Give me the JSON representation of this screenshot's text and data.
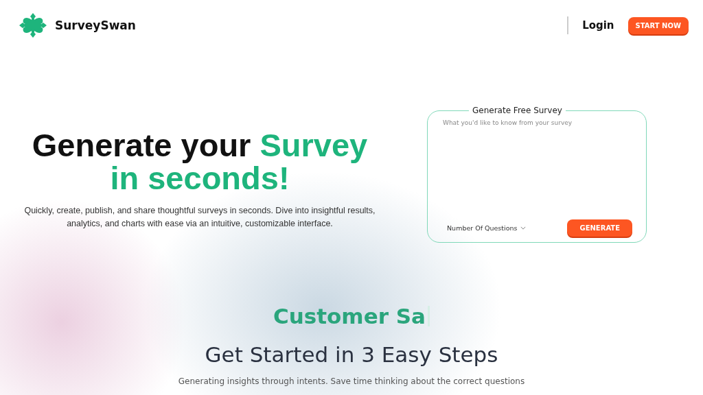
{
  "header": {
    "brand": "SurveySwan",
    "login": "Login",
    "cta": "START NOW"
  },
  "hero": {
    "headline_lines": [
      [
        {
          "text": "Generate your ",
          "accent": false
        },
        {
          "text": "Survey",
          "accent": true
        }
      ],
      [
        {
          "text": "in seconds!",
          "accent": true
        }
      ]
    ],
    "subtitle": "Quickly, create, publish, and share thoughtful surveys in seconds. Dive into insightful results, analytics, and charts with ease via an intuitive, customizable interface."
  },
  "generator": {
    "legend": "Generate Free Survey",
    "placeholder": "What you'd like to know from your survey",
    "questions_dropdown": "Number Of Questions",
    "button": "GENERATE"
  },
  "typing_text": "Customer Sa",
  "steps": {
    "title": "Get Started in 3 Easy Steps",
    "subtitle": "Generating insights through intents. Save time thinking about the correct questions"
  }
}
